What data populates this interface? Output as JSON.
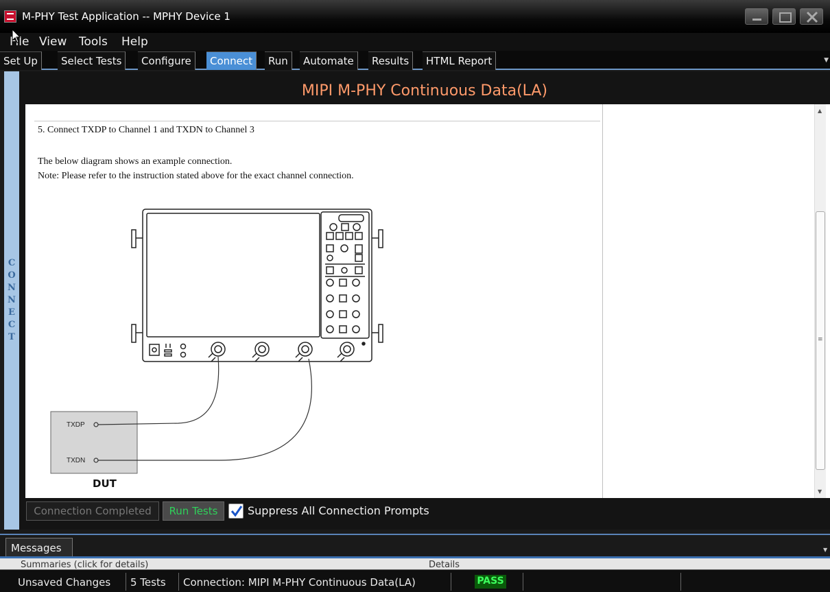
{
  "window": {
    "title": "M-PHY Test Application -- MPHY Device 1"
  },
  "menu": {
    "file": "File",
    "view": "View",
    "tools": "Tools",
    "help": "Help"
  },
  "tabs": [
    {
      "label": "Set Up"
    },
    {
      "label": "Select Tests"
    },
    {
      "label": "Configure"
    },
    {
      "label": "Connect",
      "active": true
    },
    {
      "label": "Run"
    },
    {
      "label": "Automate"
    },
    {
      "label": "Results"
    },
    {
      "label": "HTML Report"
    }
  ],
  "side_label": "CONNECT",
  "page_title": "MIPI M-PHY Continuous Data(LA)",
  "instructions": {
    "step": "5. Connect TXDP to Channel 1 and TXDN to Channel 3",
    "diagram_intro": "The below diagram shows an example connection.",
    "note": "Note: Please refer to the instruction stated above for the exact channel connection."
  },
  "diagram": {
    "dut_label": "DUT",
    "pin_1": "TXDP",
    "pin_2": "TXDN"
  },
  "actions": {
    "connection_completed": "Connection Completed",
    "run_tests": "Run Tests",
    "suppress_label": "Suppress All Connection Prompts",
    "suppress_checked": true
  },
  "messages": {
    "tab_label": "Messages",
    "summary_header": "Summaries (click for details)",
    "details_header": "Details"
  },
  "status": {
    "unsaved": "Unsaved Changes",
    "tests": "5 Tests",
    "connection": "Connection: MIPI M-PHY Continuous Data(LA)",
    "result": "PASS"
  },
  "colors": {
    "active_tab": "#4a8fd6",
    "title_text": "#ff9a6a",
    "run_tests_text": "#2fd05a",
    "pass_text": "#3cff5c"
  },
  "icons": [
    "app-icon",
    "minimize-icon",
    "maximize-icon",
    "close-icon",
    "checkbox-check-icon",
    "scroll-up-icon",
    "scroll-down-icon",
    "cursor-icon",
    "oscilloscope-icon"
  ]
}
